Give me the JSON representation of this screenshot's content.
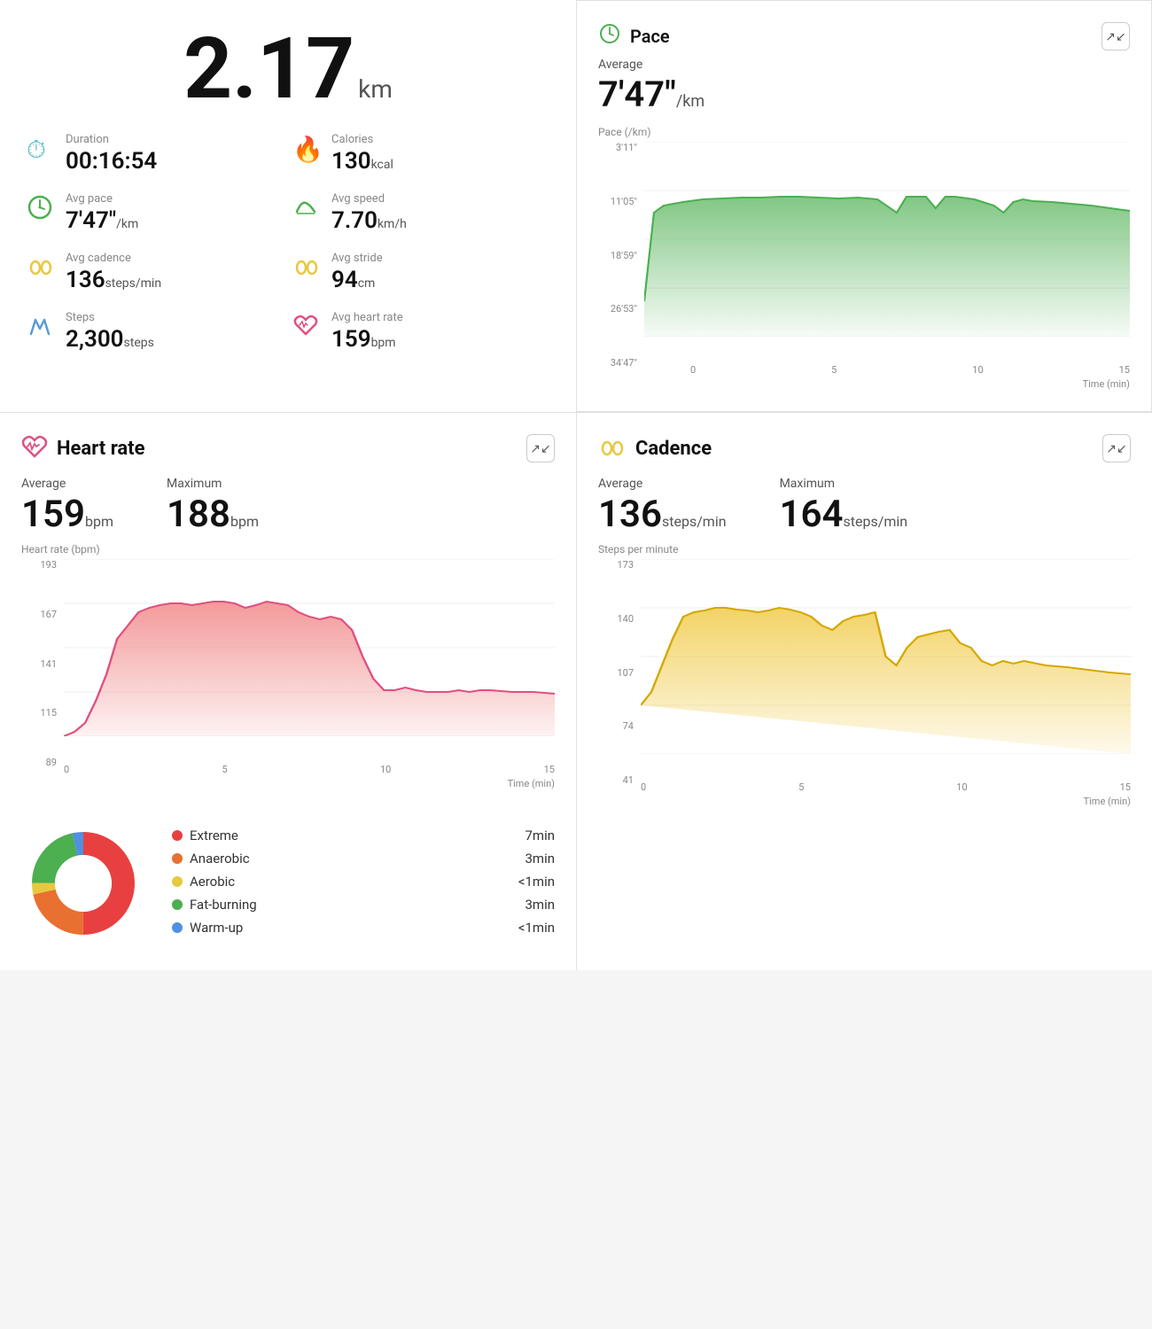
{
  "distance": {
    "value": "2.17",
    "unit": "km"
  },
  "stats": {
    "duration": {
      "label": "Duration",
      "value": "00:16:54",
      "unit": "",
      "icon": "⏱",
      "icon_color": "#4db8c8"
    },
    "calories": {
      "label": "Calories",
      "value": "130",
      "unit": "kcal",
      "icon": "🔥",
      "icon_color": "#e07050"
    },
    "avg_pace": {
      "label": "Avg pace",
      "value": "7'47\"",
      "unit": "/km",
      "icon": "⏲",
      "icon_color": "#4caf50"
    },
    "avg_speed": {
      "label": "Avg speed",
      "value": "7.70",
      "unit": "km/h",
      "icon": "🏃",
      "icon_color": "#4caf50"
    },
    "avg_cadence": {
      "label": "Avg cadence",
      "value": "136",
      "unit": "steps/min",
      "icon": "👟",
      "icon_color": "#e8c840"
    },
    "avg_stride": {
      "label": "Avg stride",
      "value": "94",
      "unit": "cm",
      "icon": "👟",
      "icon_color": "#e8c840"
    },
    "steps": {
      "label": "Steps",
      "value": "2,300",
      "unit": "steps",
      "icon": "👟",
      "icon_color": "#5b9bd5"
    },
    "avg_heart_rate": {
      "label": "Avg heart rate",
      "value": "159",
      "unit": "bpm",
      "icon": "❤",
      "icon_color": "#e05080"
    }
  },
  "pace_chart": {
    "title": "Pace",
    "icon": "⏲",
    "icon_color": "#4caf50",
    "avg_label": "Average",
    "avg_value": "7'47\"",
    "avg_unit": "/km",
    "metric_label": "Pace (/km)",
    "y_labels": [
      "3'11\"",
      "11'05\"",
      "18'59\"",
      "26'53\"",
      "34'47\""
    ],
    "x_labels": [
      "0",
      "5",
      "10",
      "15"
    ],
    "x_axis_title": "Time (min)"
  },
  "heart_rate_chart": {
    "title": "Heart rate",
    "icon": "❤",
    "icon_color": "#e05080",
    "avg_label": "Average",
    "avg_value": "159",
    "avg_unit": "bpm",
    "max_label": "Maximum",
    "max_value": "188",
    "max_unit": "bpm",
    "metric_label": "Heart rate (bpm)",
    "y_labels": [
      "193",
      "167",
      "141",
      "115",
      "89"
    ],
    "x_labels": [
      "0",
      "5",
      "10",
      "15"
    ],
    "x_axis_title": "Time (min)"
  },
  "cadence_chart": {
    "title": "Cadence",
    "icon": "👟",
    "icon_color": "#e8c840",
    "avg_label": "Average",
    "avg_value": "136",
    "avg_unit": "steps/min",
    "max_label": "Maximum",
    "max_value": "164",
    "max_unit": "steps/min",
    "metric_label": "Steps per minute",
    "y_labels": [
      "173",
      "140",
      "107",
      "74",
      "41"
    ],
    "x_labels": [
      "0",
      "5",
      "10",
      "15"
    ],
    "x_axis_title": "Time (min)"
  },
  "heart_zones": [
    {
      "name": "Extreme",
      "color": "#e84040",
      "time": "7min"
    },
    {
      "name": "Anaerobic",
      "color": "#e87030",
      "time": "3min"
    },
    {
      "name": "Aerobic",
      "color": "#e8c840",
      "time": "<1min"
    },
    {
      "name": "Fat-burning",
      "color": "#4caf50",
      "time": "3min"
    },
    {
      "name": "Warm-up",
      "color": "#5090e0",
      "time": "<1min"
    }
  ],
  "expand_label": "↗",
  "colors": {
    "green": "#4caf50",
    "red": "#e05080",
    "yellow": "#e8c840",
    "pace_fill": "#7ed98080",
    "hr_fill": "#f0808080",
    "cadence_fill": "#f0c84080"
  }
}
